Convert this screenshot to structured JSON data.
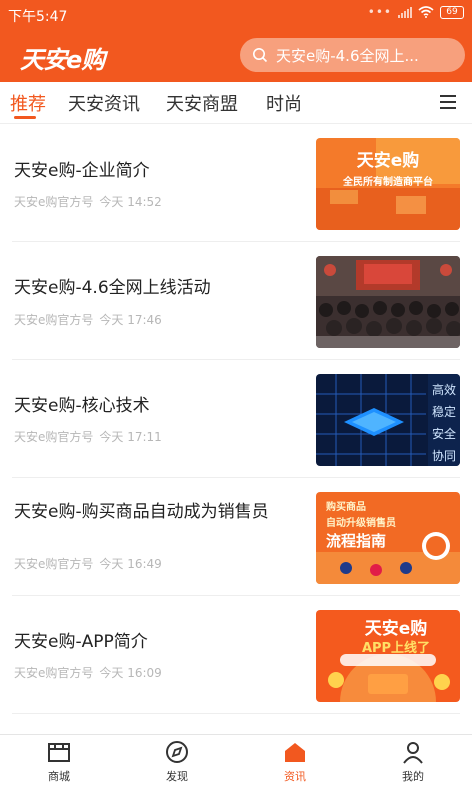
{
  "status_bar": {
    "time": "下午5:47",
    "battery": "69"
  },
  "app": {
    "logo": "天安e购"
  },
  "search": {
    "placeholder": "天安e购-4.6全网上..."
  },
  "tabs": [
    {
      "label": "推荐",
      "active": true
    },
    {
      "label": "天安资讯",
      "active": false
    },
    {
      "label": "天安商盟",
      "active": false
    },
    {
      "label": "时尚",
      "active": false
    }
  ],
  "articles": [
    {
      "title": "天安e购-企业简介",
      "source": "天安e购官方号",
      "time": "今天 14:52",
      "thumb_text": [
        "天安e购",
        "全民所有制造商平台"
      ]
    },
    {
      "title": "天安e购-4.6全网上线活动",
      "source": "天安e购官方号",
      "time": "今天 17:46"
    },
    {
      "title": "天安e购-核心技术",
      "source": "天安e购官方号",
      "time": "今天 17:11",
      "thumb_text": [
        "高效",
        "稳定",
        "安全",
        "协同"
      ]
    },
    {
      "title": "天安e购-购买商品自动成为销售员",
      "source": "天安e购官方号",
      "time": "今天 16:49",
      "thumb_text": [
        "购买商品",
        "自动升级销售员",
        "流程指南"
      ]
    },
    {
      "title": "天安e购-APP简介",
      "source": "天安e购官方号",
      "time": "今天 16:09",
      "thumb_text": [
        "天安e购",
        "APP上线了"
      ]
    }
  ],
  "bottom_nav": [
    {
      "label": "商城",
      "icon": "shop-icon",
      "active": false
    },
    {
      "label": "发现",
      "icon": "compass-icon",
      "active": false
    },
    {
      "label": "资讯",
      "icon": "home-icon",
      "active": true
    },
    {
      "label": "我的",
      "icon": "user-icon",
      "active": false
    }
  ],
  "colors": {
    "brand": "#f2581f",
    "meta_text": "#b7b7b7"
  }
}
